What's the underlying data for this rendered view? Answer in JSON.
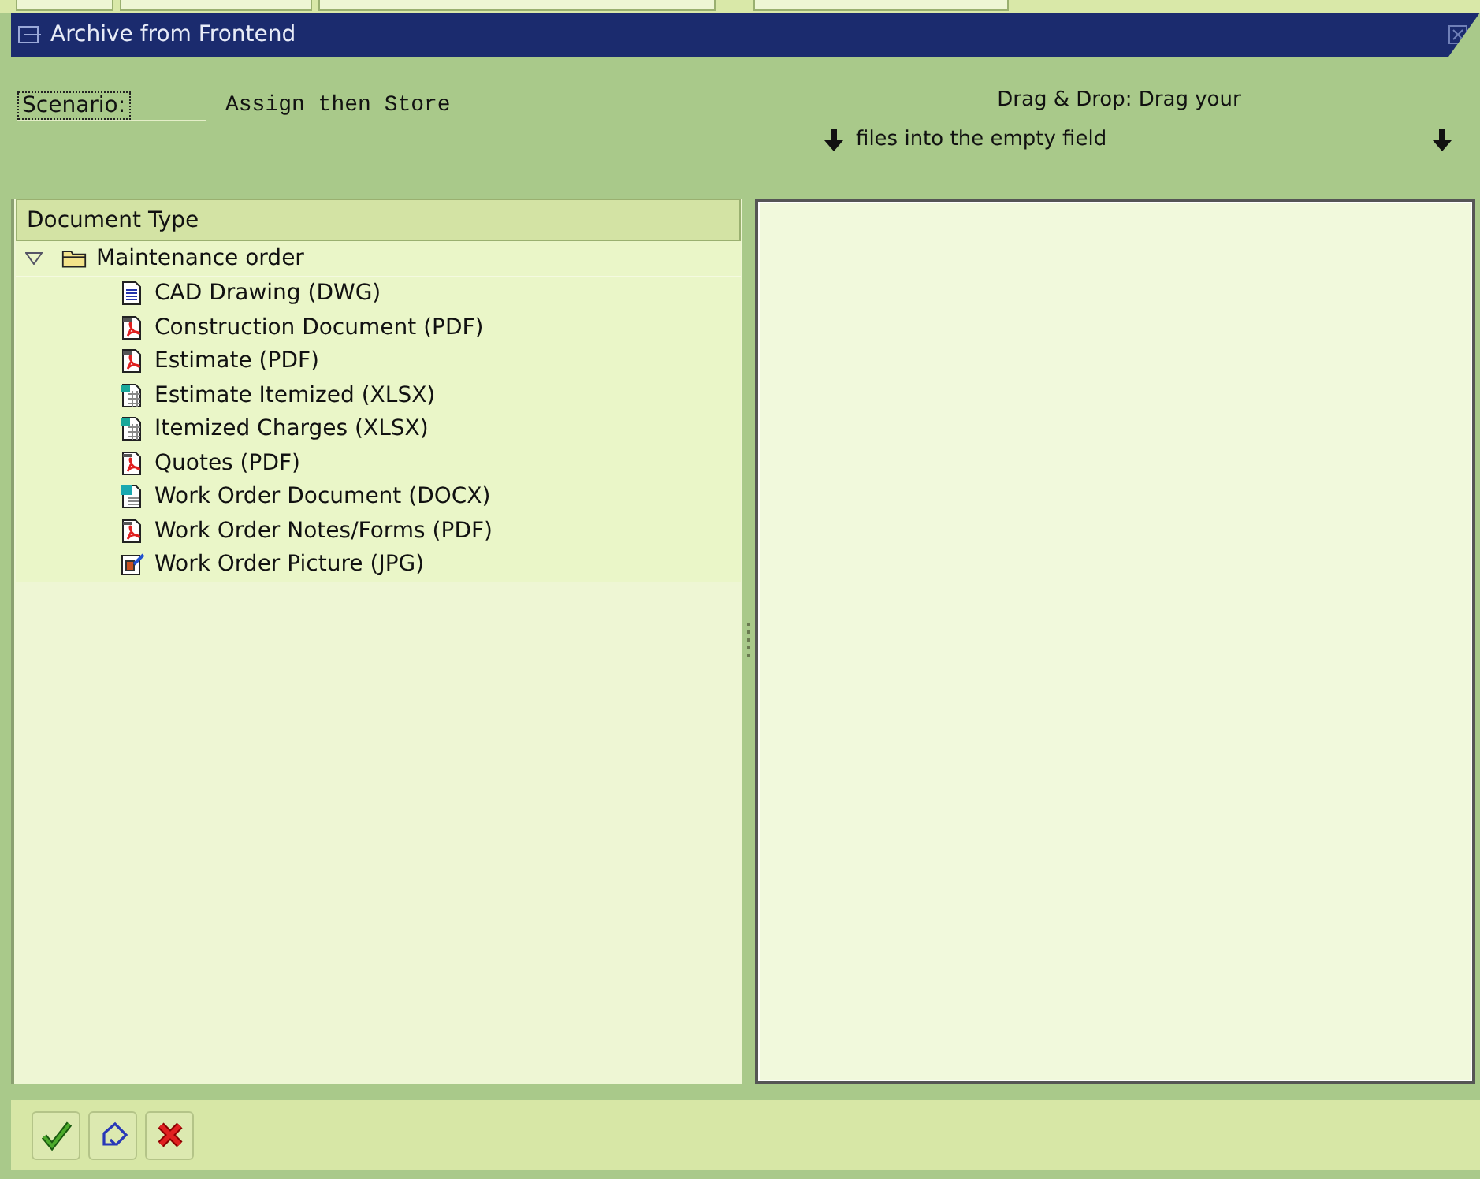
{
  "window": {
    "title": "Archive from Frontend"
  },
  "scenario": {
    "label": "Scenario:",
    "value": "Assign then Store"
  },
  "drop_hint": {
    "line_1": "Drag & Drop: Drag your",
    "line_2": "files into the empty field"
  },
  "tree": {
    "header": "Document Type",
    "nodes": [
      {
        "label": "Maintenance order",
        "kind": "folder",
        "expanded": true,
        "children": [
          {
            "label": "CAD Drawing (DWG)",
            "kind": "text"
          },
          {
            "label": "Construction Document (PDF)",
            "kind": "pdf"
          },
          {
            "label": "Estimate (PDF)",
            "kind": "pdf"
          },
          {
            "label": "Estimate Itemized (XLSX)",
            "kind": "sheet"
          },
          {
            "label": "Itemized Charges (XLSX)",
            "kind": "sheet"
          },
          {
            "label": "Quotes (PDF)",
            "kind": "pdf"
          },
          {
            "label": "Work Order Document (DOCX)",
            "kind": "word"
          },
          {
            "label": "Work Order Notes/Forms (PDF)",
            "kind": "pdf"
          },
          {
            "label": "Work Order Picture (JPG)",
            "kind": "image"
          }
        ]
      }
    ]
  },
  "toolbar": [
    {
      "kind": "confirm"
    },
    {
      "kind": "transfer"
    },
    {
      "kind": "cancel"
    }
  ]
}
